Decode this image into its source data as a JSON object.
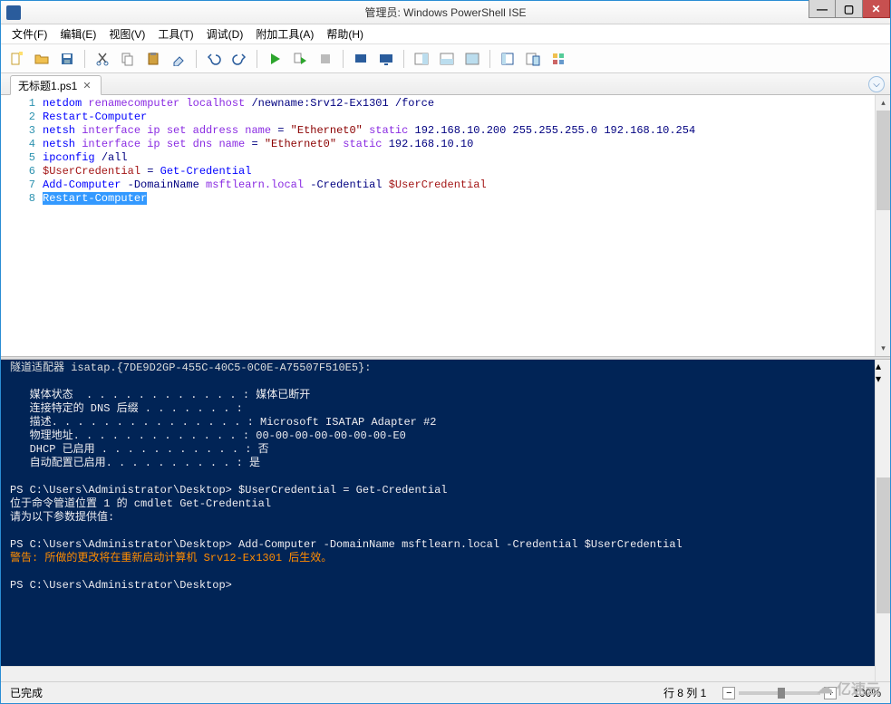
{
  "window": {
    "title": "管理员: Windows PowerShell ISE"
  },
  "menu": {
    "file": "文件(F)",
    "edit": "编辑(E)",
    "view": "视图(V)",
    "tools": "工具(T)",
    "debug": "调试(D)",
    "addons": "附加工具(A)",
    "help": "帮助(H)"
  },
  "toolbar_icons": {
    "new": "new-file-icon",
    "open": "open-folder-icon",
    "save": "save-icon",
    "cut": "cut-icon",
    "copy": "copy-icon",
    "paste": "paste-icon",
    "clear": "clear-icon",
    "undo": "undo-icon",
    "redo": "redo-icon",
    "run": "run-icon",
    "run-selection": "run-selection-icon",
    "stop": "stop-icon",
    "break": "breakpoint-icon",
    "remote": "remote-icon",
    "layout1": "layout-right-icon",
    "layout2": "layout-bottom-icon",
    "layout3": "layout-full-icon",
    "cmdaddon": "command-addon-icon",
    "showcmd": "show-command-icon",
    "extra": "toolbox-icon"
  },
  "tabs": {
    "active": {
      "label": "无标题1.ps1",
      "close": "✕"
    }
  },
  "commands_arrow": "⌵",
  "editor": {
    "lines": [
      {
        "n": "1",
        "parts": [
          [
            "cmd",
            "netdom"
          ],
          [
            "txt",
            " renamecomputer localhost "
          ],
          [
            "arg",
            "/newname:Srv12-Ex1301 /force"
          ]
        ]
      },
      {
        "n": "2",
        "parts": [
          [
            "cmd",
            "Restart-Computer"
          ]
        ]
      },
      {
        "n": "3",
        "parts": [
          [
            "cmd",
            "netsh"
          ],
          [
            "txt",
            " interface ip set address name "
          ],
          [
            "arg",
            "= "
          ],
          [
            "str",
            "\"Ethernet0\""
          ],
          [
            "txt",
            " static "
          ],
          [
            "arg",
            "192.168.10.200 255.255.255.0 192.168.10.254"
          ]
        ]
      },
      {
        "n": "4",
        "parts": [
          [
            "cmd",
            "netsh"
          ],
          [
            "txt",
            " interface ip set dns name "
          ],
          [
            "arg",
            "= "
          ],
          [
            "str",
            "\"Ethernet0\""
          ],
          [
            "txt",
            " static "
          ],
          [
            "arg",
            "192.168.10.10"
          ]
        ]
      },
      {
        "n": "5",
        "parts": [
          [
            "cmd",
            "ipconfig"
          ],
          [
            "txt",
            " "
          ],
          [
            "arg",
            "/all"
          ]
        ]
      },
      {
        "n": "6",
        "parts": [
          [
            "var",
            "$UserCredential"
          ],
          [
            "txt",
            " "
          ],
          [
            "arg",
            "="
          ],
          [
            "txt",
            " "
          ],
          [
            "cmd",
            "Get-Credential"
          ]
        ]
      },
      {
        "n": "7",
        "parts": [
          [
            "cmd",
            "Add-Computer"
          ],
          [
            "txt",
            " "
          ],
          [
            "arg",
            "-DomainName"
          ],
          [
            "txt",
            " msftlearn.local "
          ],
          [
            "arg",
            "-Credential"
          ],
          [
            "txt",
            " "
          ],
          [
            "var",
            "$UserCredential"
          ]
        ]
      },
      {
        "n": "8",
        "parts": [
          [
            "sel",
            "Restart-Computer"
          ]
        ]
      }
    ]
  },
  "console": {
    "lines": [
      {
        "cls": "trunc",
        "t": "隧道适配器 isatap.{7DE9D2GP-455C-40C5-0C0E-A75507F510E5}:"
      },
      {
        "cls": "",
        "t": ""
      },
      {
        "cls": "",
        "t": "   媒体状态  . . . . . . . . . . . . : 媒体已断开"
      },
      {
        "cls": "",
        "t": "   连接特定的 DNS 后缀 . . . . . . . :"
      },
      {
        "cls": "",
        "t": "   描述. . . . . . . . . . . . . . . : Microsoft ISATAP Adapter #2"
      },
      {
        "cls": "",
        "t": "   物理地址. . . . . . . . . . . . . : 00-00-00-00-00-00-00-E0"
      },
      {
        "cls": "",
        "t": "   DHCP 已启用 . . . . . . . . . . . : 否"
      },
      {
        "cls": "",
        "t": "   自动配置已启用. . . . . . . . . . : 是"
      },
      {
        "cls": "",
        "t": ""
      },
      {
        "cls": "",
        "t": "PS C:\\Users\\Administrator\\Desktop> $UserCredential = Get-Credential"
      },
      {
        "cls": "",
        "t": "位于命令管道位置 1 的 cmdlet Get-Credential"
      },
      {
        "cls": "",
        "t": "请为以下参数提供值:"
      },
      {
        "cls": "",
        "t": ""
      },
      {
        "cls": "",
        "t": "PS C:\\Users\\Administrator\\Desktop> Add-Computer -DomainName msftlearn.local -Credential $UserCredential"
      },
      {
        "cls": "warn",
        "t": "警告: 所做的更改将在重新启动计算机 Srv12-Ex1301 后生效。"
      },
      {
        "cls": "",
        "t": ""
      },
      {
        "cls": "",
        "t": "PS C:\\Users\\Administrator\\Desktop> "
      }
    ]
  },
  "status": {
    "left": "已完成",
    "pos": "行 8 列 1",
    "zoom": "100%"
  },
  "watermark": {
    "text": "亿速云"
  },
  "glyphs": {
    "min": "—",
    "max": "▢",
    "close": "✕",
    "chev_up": "▴",
    "chev_down": "▾"
  }
}
